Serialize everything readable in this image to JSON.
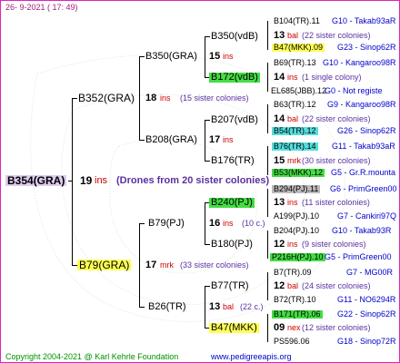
{
  "header": {
    "date": "26-  9-2021  (  17:  49)"
  },
  "footer": {
    "copyright": "Copyright 2004-2021 @ Karl Kehrle Foundation",
    "website": "www.pedigreeapis.org"
  },
  "colors": {
    "frame": "#e020c0",
    "root_bg": "#ddccee",
    "yellow": "#ffff55",
    "green": "#44dd44",
    "cyan": "#55dddd",
    "gray": "#bbbbbb"
  },
  "root": {
    "name": "B354(GRA)",
    "ins_num": "19",
    "ins_label": "ins",
    "note": "(Drones from 20 sister colonies)"
  },
  "gen1": [
    {
      "name": "B352(GRA)",
      "ins_num": "18",
      "ins_label": "ins",
      "note": "(15 sister colonies)"
    },
    {
      "name": "B79(GRA)",
      "ins_num": "17",
      "ins_label": "mrk",
      "note": "(33 sister colonies)"
    }
  ],
  "gen2": [
    {
      "name": "B350(GRA)",
      "ins_num": "15",
      "ins_label": "ins"
    },
    {
      "name": "B208(GRA)",
      "ins_num": "17",
      "ins_label": "ins"
    },
    {
      "name": "B79(PJ)",
      "ins_num": "16",
      "ins_label": "ins",
      "note": "(10 c.)"
    },
    {
      "name": "B26(TR)",
      "ins_num": "13",
      "ins_label": "bal",
      "note": "(22 c.)"
    }
  ],
  "gen3": [
    {
      "name": "B350(vdB)"
    },
    {
      "name": "B172(vdB)"
    },
    {
      "name": "B207(vdB)"
    },
    {
      "name": "B176(TR)"
    },
    {
      "name": "B240(PJ)"
    },
    {
      "name": "B180(PJ)"
    },
    {
      "name": "B77(TR)"
    },
    {
      "name": "B47(MKK)"
    }
  ],
  "gen4": [
    {
      "name": "B104(TR).11",
      "info": "G10 - Takab93aR"
    },
    {
      "ins_num": "13",
      "ins_label": "bal",
      "note": "(22 sister colonies)"
    },
    {
      "name": "B47(MKK).09",
      "info": "G23 - Sinop62R"
    },
    {
      "name": "B69(TR).13",
      "info": "G10 - Kangaroo98R"
    },
    {
      "ins_num": "14",
      "ins_label": "ins",
      "note": "(1 single colony)"
    },
    {
      "name": "EL685(JBB).12",
      "info": "G0 - Not registe"
    },
    {
      "name": "B63(TR).12",
      "info": "G9 - Kangaroo98R"
    },
    {
      "ins_num": "14",
      "ins_label": "bal",
      "note": "(22 sister colonies)"
    },
    {
      "name": "B54(TR).12",
      "info": "G26 - Sinop62R"
    },
    {
      "name": "B76(TR).14",
      "info": "G11 - Takab93aR"
    },
    {
      "ins_num": "15",
      "ins_label": "mrk",
      "note": "(30 sister colonies)"
    },
    {
      "name": "B53(MKK).12",
      "info": "G5 - Gr.R.mounta"
    },
    {
      "name": "B294(PJ).11",
      "info": "G6 - PrimGreen00"
    },
    {
      "ins_num": "13",
      "ins_label": "ins",
      "note": "(11 sister colonies)"
    },
    {
      "name": "A199(PJ).10",
      "info": "G7 - Cankiri97Q"
    },
    {
      "name": "B204(PJ).10",
      "info": "G10 - Takab93R"
    },
    {
      "ins_num": "12",
      "ins_label": "ins",
      "note": "(9 sister colonies)"
    },
    {
      "name": "P216H(PJ).10",
      "info": "G5 - PrimGreen00"
    },
    {
      "name": "B7(TR).09",
      "info": "G7 - MG00R"
    },
    {
      "ins_num": "12",
      "ins_label": "bal",
      "note": "(24 sister colonies)"
    },
    {
      "name": "B72(TR).10",
      "info": "G11 - NO6294R"
    },
    {
      "name": "B171(TR).06",
      "info": "G22 - Sinop62R"
    },
    {
      "ins_num": "09",
      "ins_label": "nex",
      "note": "(12 sister colonies)"
    },
    {
      "name": "PS596.06",
      "info": "G18 - Sinop72R"
    }
  ]
}
